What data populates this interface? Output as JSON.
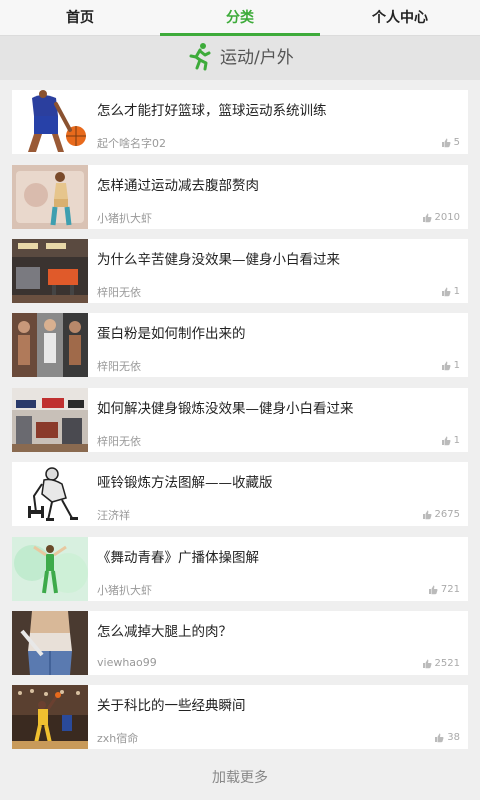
{
  "tabs": [
    {
      "label": "首页",
      "active": false
    },
    {
      "label": "分类",
      "active": true
    },
    {
      "label": "个人中心",
      "active": false
    }
  ],
  "category": {
    "title": "运动/户外",
    "icon": "running-person-icon"
  },
  "colors": {
    "accent": "#3dab3a",
    "background": "#efefef",
    "card": "#ffffff"
  },
  "items": [
    {
      "title": "怎么才能打好篮球，篮球运动系统训练",
      "author": "起个啥名字02",
      "likes": "5",
      "thumb": "basketball-player-thumbnail"
    },
    {
      "title": "怎样通过运动减去腹部赘肉",
      "author": "小猪扒大虾",
      "likes": "2010",
      "thumb": "woman-fitness-thumbnail"
    },
    {
      "title": "为什么辛苦健身没效果—健身小白看过来",
      "author": "梓阳无依",
      "likes": "1",
      "thumb": "gym-equipment-thumbnail"
    },
    {
      "title": "蛋白粉是如何制作出来的",
      "author": "梓阳无依",
      "likes": "1",
      "thumb": "fitness-models-thumbnail"
    },
    {
      "title": "如何解决健身锻炼没效果—健身小白看过来",
      "author": "梓阳无依",
      "likes": "1",
      "thumb": "gym-interior-thumbnail"
    },
    {
      "title": "哑铃锻炼方法图解——收藏版",
      "author": "汪济祥",
      "likes": "2675",
      "thumb": "dumbbell-exercise-thumbnail"
    },
    {
      "title": "《舞动青春》广播体操图解",
      "author": "小猪扒大虾",
      "likes": "721",
      "thumb": "gymnastics-thumbnail"
    },
    {
      "title": "怎么减掉大腿上的肉？",
      "author": "viewhao99",
      "likes": "2521",
      "thumb": "thigh-thumbnail"
    },
    {
      "title": "关于科比的一些经典瞬间",
      "author": "zxh宿命",
      "likes": "38",
      "thumb": "kobe-basketball-thumbnail"
    }
  ],
  "load_more": "加载更多"
}
